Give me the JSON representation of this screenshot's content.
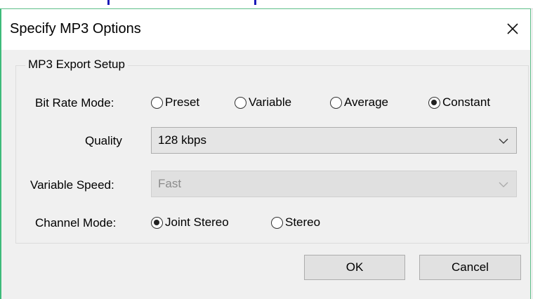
{
  "dialog": {
    "title": "Specify MP3 Options",
    "close_icon": "close-icon"
  },
  "group": {
    "legend": "MP3 Export Setup"
  },
  "bit_rate_mode": {
    "label": "Bit Rate Mode:",
    "options": [
      "Preset",
      "Variable",
      "Average",
      "Constant"
    ],
    "selected": "Constant"
  },
  "quality": {
    "label": "Quality",
    "value": "128 kbps",
    "icon": "chevron-down-icon"
  },
  "variable_speed": {
    "label": "Variable Speed:",
    "value": "Fast",
    "disabled": true,
    "icon": "chevron-down-icon"
  },
  "channel_mode": {
    "label": "Channel Mode:",
    "options": [
      "Joint Stereo",
      "Stereo"
    ],
    "selected": "Joint Stereo"
  },
  "buttons": {
    "ok": "OK",
    "cancel": "Cancel"
  },
  "colors": {
    "dialog_bg": "#f0f0f0",
    "titlebar_bg": "#ffffff",
    "accent_border": "#3dbb7a",
    "disabled_text": "#8c8c8c"
  }
}
